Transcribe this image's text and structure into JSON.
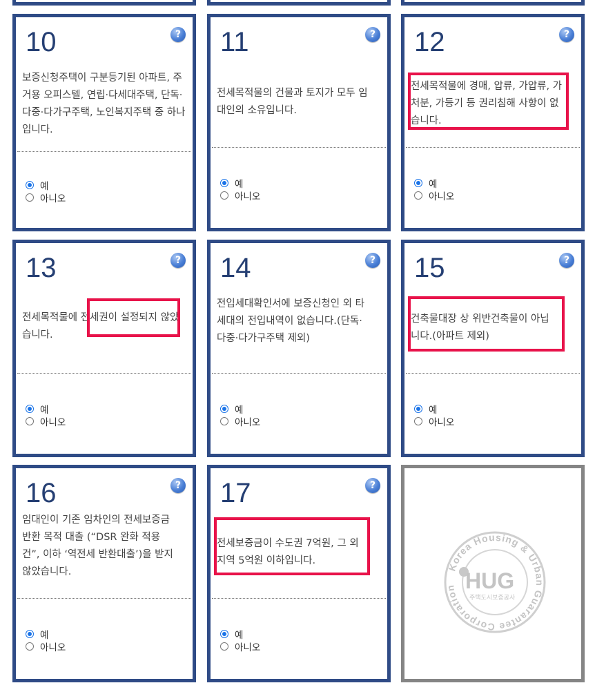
{
  "cards": [
    {
      "number": "10",
      "description": "보증신청주택이 구분등기된 아파트, 주거용 오피스텔, 연립·다세대주택, 단독·다중·다가구주택, 노인복지주택 중 하나입니다.",
      "options": [
        "예",
        "아니오"
      ],
      "selected": "예"
    },
    {
      "number": "11",
      "description": "전세목적물의 건물과 토지가 모두 임대인의 소유입니다.",
      "options": [
        "예",
        "아니오"
      ],
      "selected": "예"
    },
    {
      "number": "12",
      "description": "전세목적물에 경매, 압류, 가압류, 가처분, 가등기 등 권리침해 사항이 없습니다.",
      "options": [
        "예",
        "아니오"
      ],
      "selected": "예"
    },
    {
      "number": "13",
      "description": "전세목적물에 전세권이 설정되지 않았습니다.",
      "options": [
        "예",
        "아니오"
      ],
      "selected": "예"
    },
    {
      "number": "14",
      "description": "전입세대확인서에 보증신청인 외 타세대의 전입내역이 없습니다.(단독·다중·다가구주택 제외)",
      "options": [
        "예",
        "아니오"
      ],
      "selected": "예"
    },
    {
      "number": "15",
      "description": "건축물대장 상 위반건축물이 아닙니다.(아파트 제외)",
      "options": [
        "예",
        "아니오"
      ],
      "selected": "예"
    },
    {
      "number": "16",
      "description": "임대인이 기존 임차인의 전세보증금 반환 목적 대출 (“DSR 완화 적용 건”, 이하 ‘역전세 반환대출’)을 받지 않았습니다.",
      "options": [
        "예",
        "아니오"
      ],
      "selected": "예"
    },
    {
      "number": "17",
      "description": "전세보증금이 수도권 7억원, 그 외 지역 5억원 이하입니다.",
      "options": [
        "예",
        "아니오"
      ],
      "selected": "예"
    }
  ],
  "help_icon": {
    "name": "question-icon",
    "glyph": "?"
  },
  "colors": {
    "card_border": "#2f4b86",
    "highlight": "#e8134a",
    "radio_checked": "#1a73e8",
    "number": "#253f73"
  },
  "logo": {
    "ring_text": "Korea Housing & Urban Guarantee Corporation",
    "wordmark": "HUG",
    "korean_name": "주택도시보증공사"
  }
}
